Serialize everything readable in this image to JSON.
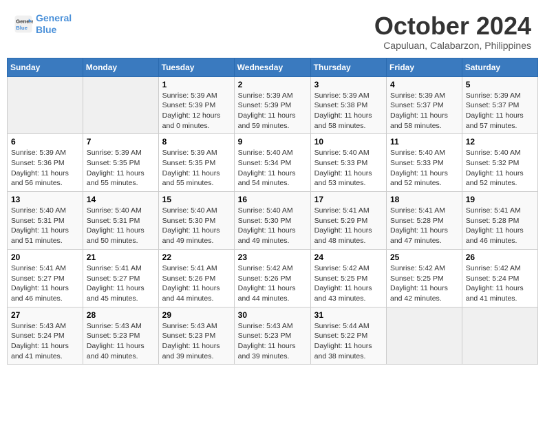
{
  "header": {
    "logo_line1": "General",
    "logo_line2": "Blue",
    "month": "October 2024",
    "location": "Capuluan, Calabarzon, Philippines"
  },
  "weekdays": [
    "Sunday",
    "Monday",
    "Tuesday",
    "Wednesday",
    "Thursday",
    "Friday",
    "Saturday"
  ],
  "weeks": [
    [
      {
        "day": "",
        "info": ""
      },
      {
        "day": "",
        "info": ""
      },
      {
        "day": "1",
        "info": "Sunrise: 5:39 AM\nSunset: 5:39 PM\nDaylight: 12 hours\nand 0 minutes."
      },
      {
        "day": "2",
        "info": "Sunrise: 5:39 AM\nSunset: 5:39 PM\nDaylight: 11 hours\nand 59 minutes."
      },
      {
        "day": "3",
        "info": "Sunrise: 5:39 AM\nSunset: 5:38 PM\nDaylight: 11 hours\nand 58 minutes."
      },
      {
        "day": "4",
        "info": "Sunrise: 5:39 AM\nSunset: 5:37 PM\nDaylight: 11 hours\nand 58 minutes."
      },
      {
        "day": "5",
        "info": "Sunrise: 5:39 AM\nSunset: 5:37 PM\nDaylight: 11 hours\nand 57 minutes."
      }
    ],
    [
      {
        "day": "6",
        "info": "Sunrise: 5:39 AM\nSunset: 5:36 PM\nDaylight: 11 hours\nand 56 minutes."
      },
      {
        "day": "7",
        "info": "Sunrise: 5:39 AM\nSunset: 5:35 PM\nDaylight: 11 hours\nand 55 minutes."
      },
      {
        "day": "8",
        "info": "Sunrise: 5:39 AM\nSunset: 5:35 PM\nDaylight: 11 hours\nand 55 minutes."
      },
      {
        "day": "9",
        "info": "Sunrise: 5:40 AM\nSunset: 5:34 PM\nDaylight: 11 hours\nand 54 minutes."
      },
      {
        "day": "10",
        "info": "Sunrise: 5:40 AM\nSunset: 5:33 PM\nDaylight: 11 hours\nand 53 minutes."
      },
      {
        "day": "11",
        "info": "Sunrise: 5:40 AM\nSunset: 5:33 PM\nDaylight: 11 hours\nand 52 minutes."
      },
      {
        "day": "12",
        "info": "Sunrise: 5:40 AM\nSunset: 5:32 PM\nDaylight: 11 hours\nand 52 minutes."
      }
    ],
    [
      {
        "day": "13",
        "info": "Sunrise: 5:40 AM\nSunset: 5:31 PM\nDaylight: 11 hours\nand 51 minutes."
      },
      {
        "day": "14",
        "info": "Sunrise: 5:40 AM\nSunset: 5:31 PM\nDaylight: 11 hours\nand 50 minutes."
      },
      {
        "day": "15",
        "info": "Sunrise: 5:40 AM\nSunset: 5:30 PM\nDaylight: 11 hours\nand 49 minutes."
      },
      {
        "day": "16",
        "info": "Sunrise: 5:40 AM\nSunset: 5:30 PM\nDaylight: 11 hours\nand 49 minutes."
      },
      {
        "day": "17",
        "info": "Sunrise: 5:41 AM\nSunset: 5:29 PM\nDaylight: 11 hours\nand 48 minutes."
      },
      {
        "day": "18",
        "info": "Sunrise: 5:41 AM\nSunset: 5:28 PM\nDaylight: 11 hours\nand 47 minutes."
      },
      {
        "day": "19",
        "info": "Sunrise: 5:41 AM\nSunset: 5:28 PM\nDaylight: 11 hours\nand 46 minutes."
      }
    ],
    [
      {
        "day": "20",
        "info": "Sunrise: 5:41 AM\nSunset: 5:27 PM\nDaylight: 11 hours\nand 46 minutes."
      },
      {
        "day": "21",
        "info": "Sunrise: 5:41 AM\nSunset: 5:27 PM\nDaylight: 11 hours\nand 45 minutes."
      },
      {
        "day": "22",
        "info": "Sunrise: 5:41 AM\nSunset: 5:26 PM\nDaylight: 11 hours\nand 44 minutes."
      },
      {
        "day": "23",
        "info": "Sunrise: 5:42 AM\nSunset: 5:26 PM\nDaylight: 11 hours\nand 44 minutes."
      },
      {
        "day": "24",
        "info": "Sunrise: 5:42 AM\nSunset: 5:25 PM\nDaylight: 11 hours\nand 43 minutes."
      },
      {
        "day": "25",
        "info": "Sunrise: 5:42 AM\nSunset: 5:25 PM\nDaylight: 11 hours\nand 42 minutes."
      },
      {
        "day": "26",
        "info": "Sunrise: 5:42 AM\nSunset: 5:24 PM\nDaylight: 11 hours\nand 41 minutes."
      }
    ],
    [
      {
        "day": "27",
        "info": "Sunrise: 5:43 AM\nSunset: 5:24 PM\nDaylight: 11 hours\nand 41 minutes."
      },
      {
        "day": "28",
        "info": "Sunrise: 5:43 AM\nSunset: 5:23 PM\nDaylight: 11 hours\nand 40 minutes."
      },
      {
        "day": "29",
        "info": "Sunrise: 5:43 AM\nSunset: 5:23 PM\nDaylight: 11 hours\nand 39 minutes."
      },
      {
        "day": "30",
        "info": "Sunrise: 5:43 AM\nSunset: 5:23 PM\nDaylight: 11 hours\nand 39 minutes."
      },
      {
        "day": "31",
        "info": "Sunrise: 5:44 AM\nSunset: 5:22 PM\nDaylight: 11 hours\nand 38 minutes."
      },
      {
        "day": "",
        "info": ""
      },
      {
        "day": "",
        "info": ""
      }
    ]
  ]
}
